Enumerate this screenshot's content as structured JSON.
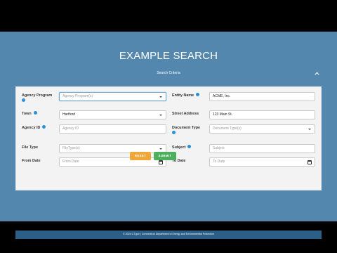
{
  "page": {
    "title": "EXAMPLE SEARCH",
    "criteria_label": "Search Criteria"
  },
  "form": {
    "agency_program": {
      "label": "Agency Program",
      "placeholder": "Agency Program(s)"
    },
    "entity_name": {
      "label": "Entity Name",
      "value": "ACME, Inc."
    },
    "town": {
      "label": "Town",
      "value": "Hartford"
    },
    "street_address": {
      "label": "Street Address",
      "value": "123 Main St."
    },
    "agency_id": {
      "label": "Agency ID",
      "placeholder": "Agency ID"
    },
    "document_type": {
      "label": "Document Type",
      "placeholder": "Document Type(s)"
    },
    "file_type": {
      "label": "File Type",
      "placeholder": "FileType(s)"
    },
    "subject": {
      "label": "Subject",
      "placeholder": "Subject"
    },
    "from_date": {
      "label": "From Date",
      "placeholder": "From Date"
    },
    "to_date": {
      "label": "To Date",
      "placeholder": "To Date"
    }
  },
  "buttons": {
    "reset": "RESET",
    "submit": "SUBMIT"
  },
  "footer": {
    "text": "© 2024 CT.gov | Connecticut Department of Energy and Environmental Protection"
  },
  "icons": [
    "chevron-up-icon",
    "info-icon",
    "caret-down-icon",
    "calendar-icon"
  ],
  "colors": {
    "background": "#5387ad",
    "panel": "#f3f3f3",
    "footer": "#2d5f86",
    "info": "#2c8fd6",
    "reset": "#f0a73a",
    "submit": "#4caf5e"
  }
}
